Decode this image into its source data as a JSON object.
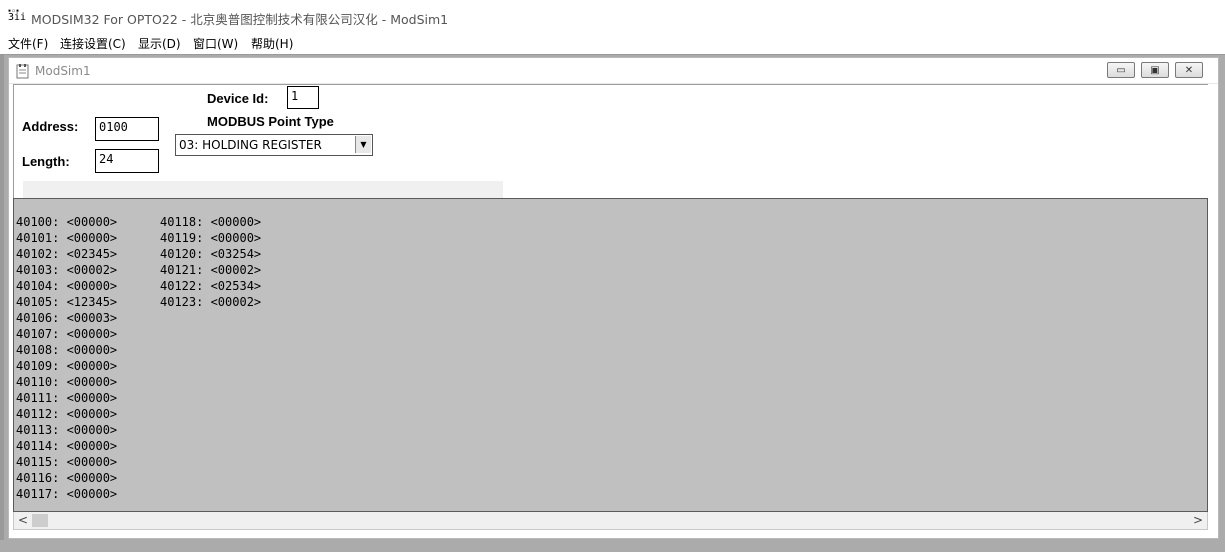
{
  "app": {
    "title": "MODSIM32 For OPTO22 - 北京奥普图控制技术有限公司汉化 - ModSim1",
    "icon": "modsim-app-icon"
  },
  "menu": {
    "items": [
      {
        "label": "文件(F)"
      },
      {
        "label": "连接设置(C)"
      },
      {
        "label": "显示(D)"
      },
      {
        "label": "窗口(W)"
      },
      {
        "label": "帮助(H)"
      }
    ]
  },
  "child": {
    "title": "ModSim1",
    "minimize": "▭",
    "restore": "▣",
    "close": "✕"
  },
  "form": {
    "device_id_label": "Device Id:",
    "device_id_value": "1",
    "address_label": "Address:",
    "address_value": "0100",
    "length_label": "Length:",
    "length_value": "24",
    "point_type_label": "MODBUS Point Type",
    "point_type_value": "03: HOLDING REGISTER"
  },
  "registers": {
    "col1": [
      "40100: <00000>",
      "40101: <00000>",
      "40102: <02345>",
      "40103: <00002>",
      "40104: <00000>",
      "40105: <12345>",
      "40106: <00003>",
      "40107: <00000>",
      "40108: <00000>",
      "40109: <00000>",
      "40110: <00000>",
      "40111: <00000>",
      "40112: <00000>",
      "40113: <00000>",
      "40114: <00000>",
      "40115: <00000>",
      "40116: <00000>",
      "40117: <00000>"
    ],
    "col2": [
      "40118: <00000>",
      "40119: <00000>",
      "40120: <03254>",
      "40121: <00002>",
      "40122: <02534>",
      "40123: <00002>"
    ]
  },
  "scrollbar": {
    "left_arrow": "<",
    "right_arrow": ">"
  }
}
